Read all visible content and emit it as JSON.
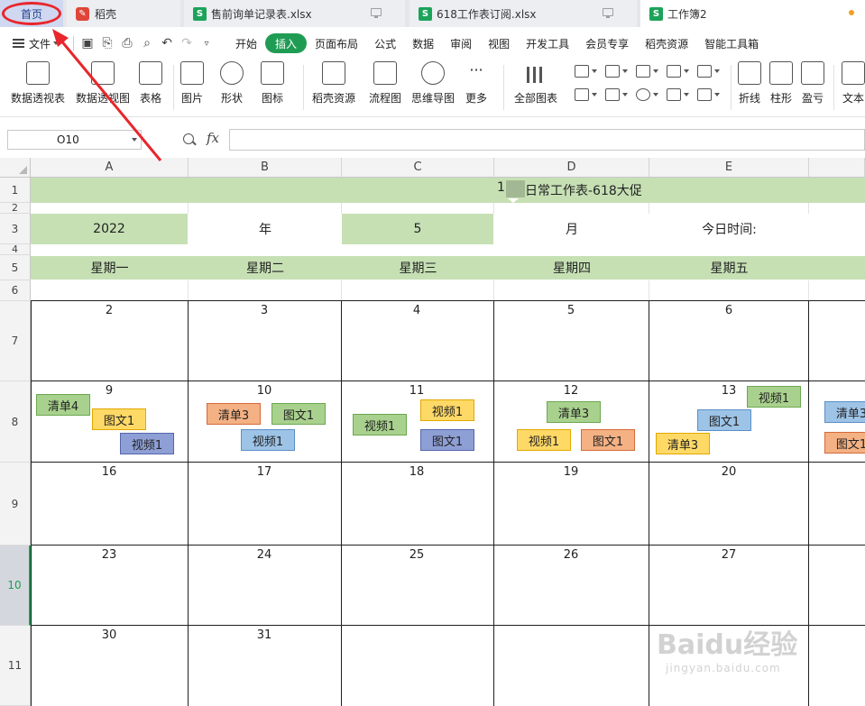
{
  "tabs": {
    "home": "首页",
    "daoke": "稻壳",
    "file1": "售前询单记录表.xlsx",
    "file2": "618工作表订阅.xlsx",
    "file3": "工作簿2",
    "sheet_badge": "S"
  },
  "menu": {
    "file": "文件",
    "items": [
      "开始",
      "插入",
      "页面布局",
      "公式",
      "数据",
      "审阅",
      "视图",
      "开发工具",
      "会员专享",
      "稻壳资源",
      "智能工具箱"
    ]
  },
  "ribbon": {
    "pivot_table": "数据透视表",
    "pivot_chart": "数据透视图",
    "table": "表格",
    "picture": "图片",
    "shape": "形状",
    "icon": "图标",
    "daoke_res": "稻壳资源",
    "flowchart": "流程图",
    "mindmap": "思维导图",
    "more": "更多",
    "all_charts": "全部图表",
    "line": "折线",
    "bar": "柱形",
    "winloss": "盈亏",
    "text": "文本"
  },
  "formula_bar": {
    "name_box": "O10",
    "fx": "fx",
    "content": ""
  },
  "columns": [
    "A",
    "B",
    "C",
    "D",
    "E"
  ],
  "rows": [
    "1",
    "2",
    "3",
    "4",
    "5",
    "6",
    "7",
    "8",
    "9",
    "10",
    "11"
  ],
  "sheet": {
    "title": "日常工作表-618大促",
    "title_prefix": "1",
    "year": "2022",
    "year_label": "年",
    "month": "5",
    "month_label": "月",
    "today_label": "今日时间:",
    "weekdays": [
      "星期一",
      "星期二",
      "星期三",
      "星期四",
      "星期五"
    ],
    "week1": [
      "2",
      "3",
      "4",
      "5",
      "6"
    ],
    "week2": [
      "9",
      "10",
      "11",
      "12",
      "13"
    ],
    "week3": [
      "16",
      "17",
      "18",
      "19",
      "20"
    ],
    "week4": [
      "23",
      "24",
      "25",
      "26",
      "27"
    ],
    "week5": [
      "30",
      "31"
    ]
  },
  "tags": {
    "a1": "清单4",
    "a2": "图文1",
    "a3": "视频1",
    "b1": "清单3",
    "b2": "图文1",
    "b3": "视频1",
    "c1": "视频1",
    "c2": "视频1",
    "c3": "图文1",
    "d1": "清单3",
    "d2": "视频1",
    "d3": "图文1",
    "e1": "视频1",
    "e2": "图文1",
    "e3": "清单3",
    "f1": "清单3",
    "f2": "图文1"
  },
  "watermark": {
    "brand": "Baidu经验",
    "url": "jingyan.baidu.com"
  },
  "colors": {
    "band_green": "#c6e0b4",
    "accent_green": "#1f9c53",
    "annotation_red": "#e8262b"
  }
}
